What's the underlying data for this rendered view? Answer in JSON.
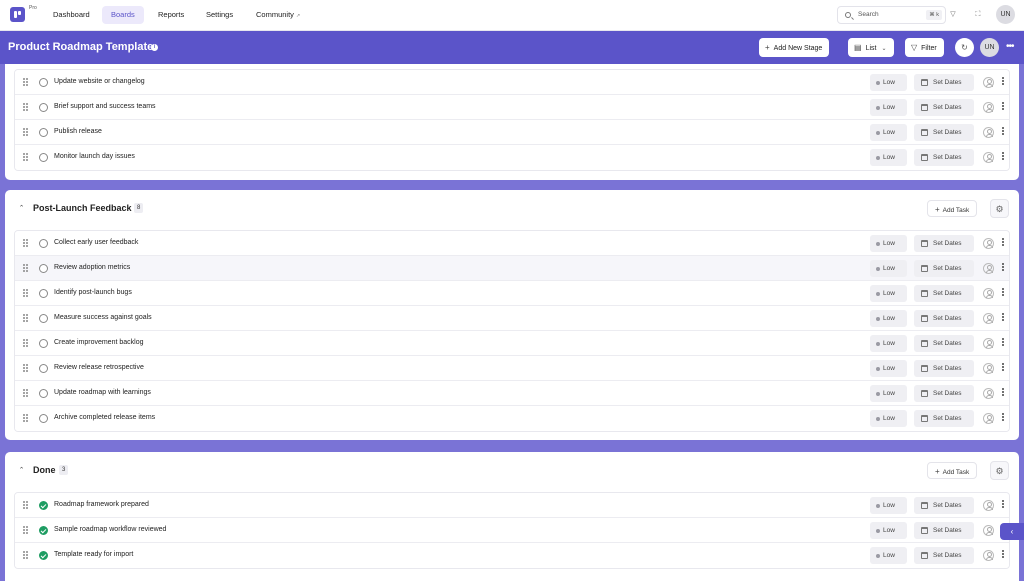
{
  "nav": {
    "badge": "Pro",
    "items": [
      {
        "label": "Dashboard"
      },
      {
        "label": "Boards",
        "active": true
      },
      {
        "label": "Reports"
      },
      {
        "label": "Settings"
      },
      {
        "label": "Community",
        "external": "↗"
      }
    ],
    "search_placeholder": "Search",
    "search_shortcut": "⌘ k",
    "user_initials": "UN"
  },
  "header": {
    "title": "Product Roadmap Template",
    "add_stage_label": "Add New Stage",
    "view_label": "List",
    "filter_label": "Filter",
    "user_initials": "UN"
  },
  "stages": [
    {
      "title": "",
      "tasks": [
        {
          "name": "Update website or changelog",
          "priority": "Low",
          "dates": "Set Dates",
          "done": false
        },
        {
          "name": "Brief support and success teams",
          "priority": "Low",
          "dates": "Set Dates",
          "done": false
        },
        {
          "name": "Publish release",
          "priority": "Low",
          "dates": "Set Dates",
          "done": false
        },
        {
          "name": "Monitor launch day issues",
          "priority": "Low",
          "dates": "Set Dates",
          "done": false
        }
      ]
    },
    {
      "title": "Post-Launch Feedback",
      "count": "8",
      "add_task_label": "Add Task",
      "tasks": [
        {
          "name": "Collect early user feedback",
          "priority": "Low",
          "dates": "Set Dates",
          "done": false
        },
        {
          "name": "Review adoption metrics",
          "priority": "Low",
          "dates": "Set Dates",
          "done": false
        },
        {
          "name": "Identify post-launch bugs",
          "priority": "Low",
          "dates": "Set Dates",
          "done": false
        },
        {
          "name": "Measure success against goals",
          "priority": "Low",
          "dates": "Set Dates",
          "done": false
        },
        {
          "name": "Create improvement backlog",
          "priority": "Low",
          "dates": "Set Dates",
          "done": false
        },
        {
          "name": "Review release retrospective",
          "priority": "Low",
          "dates": "Set Dates",
          "done": false
        },
        {
          "name": "Update roadmap with learnings",
          "priority": "Low",
          "dates": "Set Dates",
          "done": false
        },
        {
          "name": "Archive completed release items",
          "priority": "Low",
          "dates": "Set Dates",
          "done": false
        }
      ]
    },
    {
      "title": "Done",
      "count": "3",
      "add_task_label": "Add Task",
      "tasks": [
        {
          "name": "Roadmap framework prepared",
          "priority": "Low",
          "dates": "Set Dates",
          "done": true
        },
        {
          "name": "Sample roadmap workflow reviewed",
          "priority": "Low",
          "dates": "Set Dates",
          "done": true
        },
        {
          "name": "Template ready for import",
          "priority": "Low",
          "dates": "Set Dates",
          "done": true
        }
      ]
    }
  ],
  "colors": {
    "brand": "#5b54c9",
    "header_bg": "#5b54c9",
    "done_green": "#1f9d63"
  }
}
